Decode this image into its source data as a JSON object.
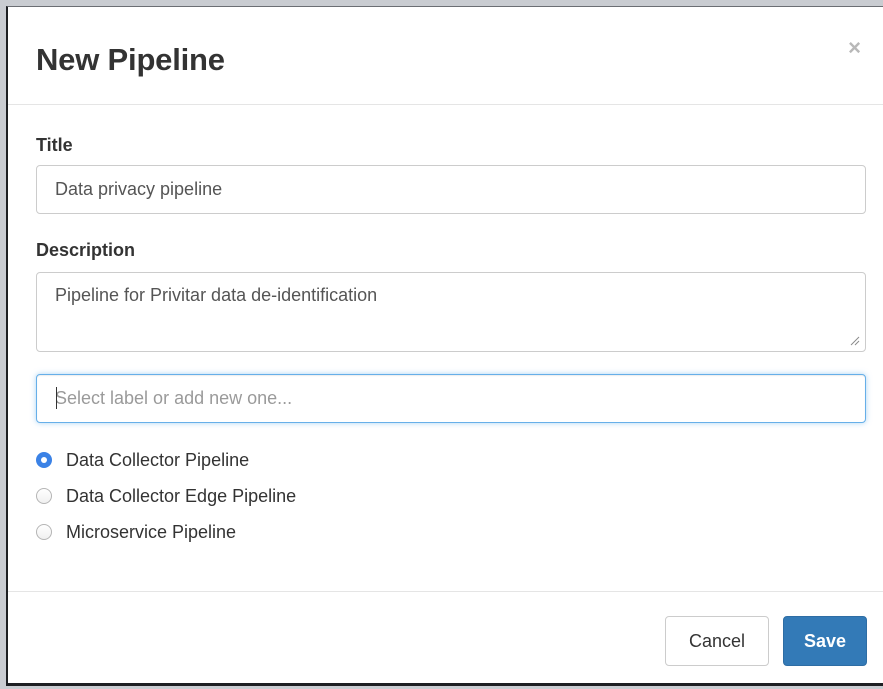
{
  "dialog": {
    "title": "New Pipeline",
    "close_symbol": "×"
  },
  "form": {
    "title_label": "Title",
    "title_value": "Data privacy pipeline",
    "description_label": "Description",
    "description_value": "Pipeline for Privitar data de-identification",
    "labels_placeholder": "Select label or add new one...",
    "pipeline_types": [
      {
        "label": "Data Collector Pipeline",
        "selected": true
      },
      {
        "label": "Data Collector Edge Pipeline",
        "selected": false
      },
      {
        "label": "Microservice Pipeline",
        "selected": false
      }
    ]
  },
  "footer": {
    "cancel_label": "Cancel",
    "save_label": "Save"
  },
  "colors": {
    "primary": "#337ab7",
    "radio_checked": "#3b82e6",
    "focus_border": "#66afe9"
  }
}
